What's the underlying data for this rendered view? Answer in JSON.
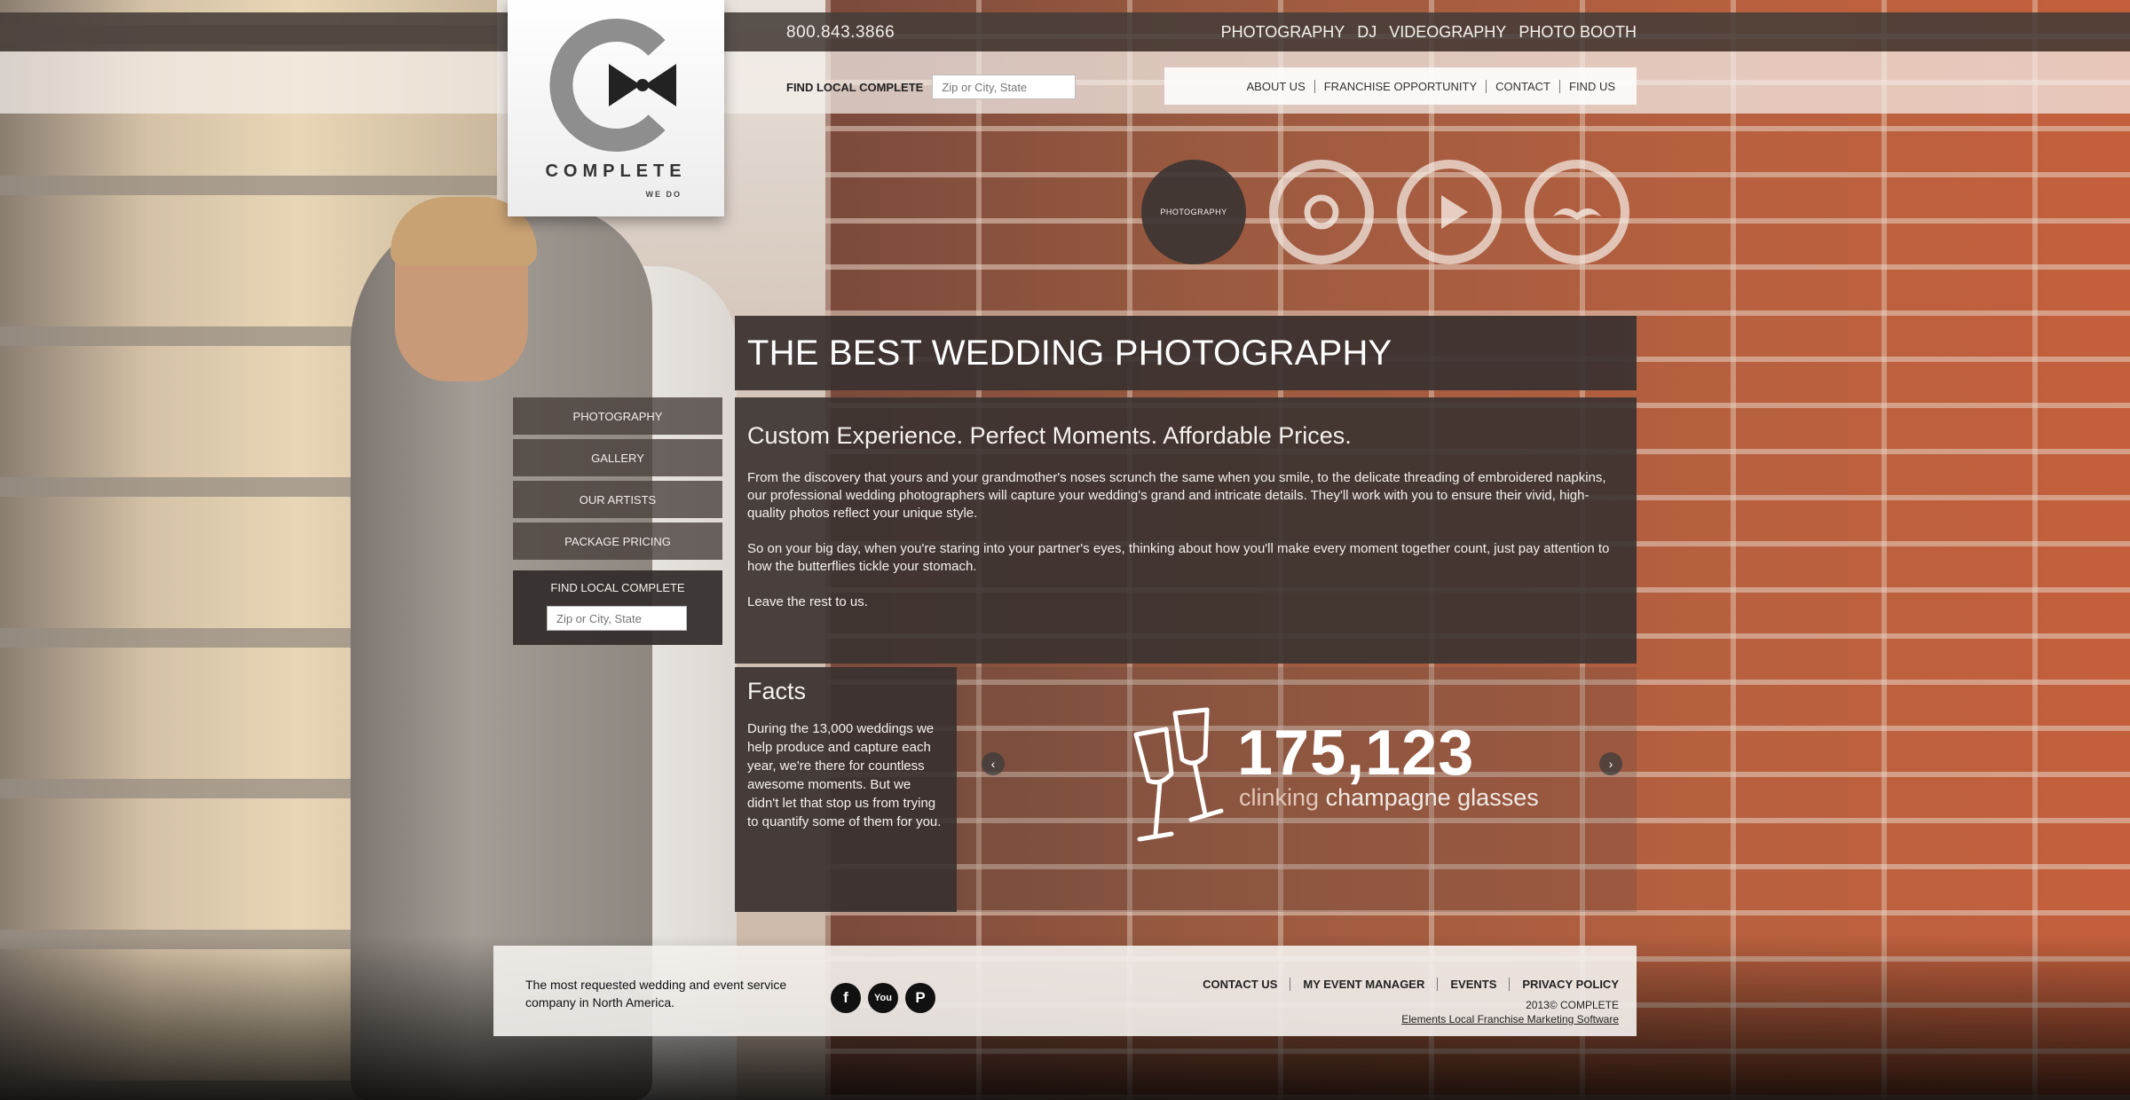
{
  "header": {
    "phone": "800.843.3866",
    "main_nav": [
      "PHOTOGRAPHY",
      "DJ",
      "VIDEOGRAPHY",
      "PHOTO BOOTH"
    ],
    "find_label": "FIND LOCAL COMPLETE",
    "find_placeholder": "Zip or City, State",
    "util_nav": [
      "ABOUT US",
      "FRANCHISE OPPORTUNITY",
      "CONTACT",
      "FIND US"
    ]
  },
  "logo": {
    "brand": "COMPLETE",
    "tagline": "WE DO"
  },
  "services": [
    {
      "label": "PHOTOGRAPHY",
      "icon": "aperture-icon",
      "active": true
    },
    {
      "label": "",
      "icon": "record-icon",
      "active": false
    },
    {
      "label": "",
      "icon": "play-icon",
      "active": false
    },
    {
      "label": "",
      "icon": "mustache-icon",
      "active": false
    }
  ],
  "main": {
    "headline": "THE BEST WEDDING PHOTOGRAPHY",
    "subhead": "Custom Experience. Perfect Moments. Affordable Prices.",
    "paragraphs": [
      "From the discovery that yours and your grandmother's noses scrunch the same when you smile, to the delicate threading of embroidered napkins, our professional wedding photographers will capture your wedding's grand and intricate details. They'll work with you to ensure their vivid, high-quality photos reflect your unique style.",
      "So on your big day, when you're staring into your partner's eyes, thinking about how you'll make every moment together count, just pay attention to how the butterflies tickle your stomach.",
      "Leave the rest to us."
    ]
  },
  "side_menu": {
    "items": [
      "PHOTOGRAPHY",
      "GALLERY",
      "OUR ARTISTS",
      "PACKAGE PRICING"
    ],
    "find_label": "FIND LOCAL COMPLETE",
    "find_placeholder": "Zip or City, State"
  },
  "facts": {
    "title": "Facts",
    "body": "During the 13,000 weddings we help produce and capture each year, we're there for countless awesome moments. But we didn't let that stop us from trying to quantify some of them for you.",
    "stat_number": "175,123",
    "stat_label_soft": "clinking",
    "stat_label_strong": "champagne glasses",
    "prev": "‹",
    "next": "›"
  },
  "footer": {
    "tagline": "The most requested wedding and event service company in North America.",
    "social": [
      "f",
      "You",
      "P"
    ],
    "nav": [
      "CONTACT US",
      "MY EVENT MANAGER",
      "EVENTS",
      "PRIVACY POLICY"
    ],
    "copyright": "2013© COMPLETE",
    "powered": "Elements Local Franchise Marketing Software"
  },
  "colors": {
    "panel": "#3a3230",
    "topbar": "#463c38",
    "accent_soft": "#e2c6b7"
  }
}
